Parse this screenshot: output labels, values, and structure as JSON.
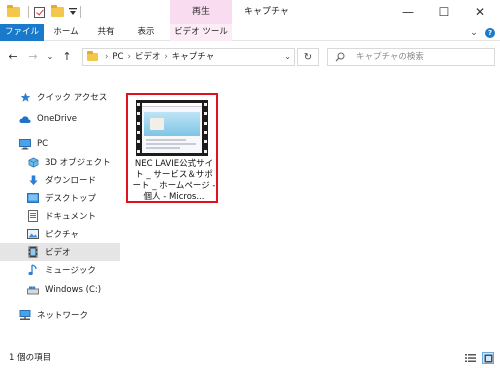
{
  "window": {
    "title": "キャプチャ",
    "context_group": "再生",
    "minimize_glyph": "—",
    "maximize_glyph": "☐",
    "close_glyph": "✕"
  },
  "ribbon": {
    "tabs": [
      {
        "label": "ファイル"
      },
      {
        "label": "ホーム"
      },
      {
        "label": "共有"
      },
      {
        "label": "表示"
      },
      {
        "label": "ビデオ ツール"
      }
    ],
    "expand_glyph": "⌄",
    "help_glyph": "?"
  },
  "nav": {
    "back_glyph": "←",
    "forward_glyph": "→",
    "recent_glyph": "⌄",
    "up_glyph": "↑",
    "address": {
      "segments": [
        "PC",
        "ビデオ",
        "キャプチャ"
      ],
      "separator": "›",
      "lead_separator": "›",
      "dropdown_glyph": "⌄"
    },
    "refresh_glyph": "↻",
    "search": {
      "placeholder": "キャプチャの検索"
    }
  },
  "sidebar": {
    "items": [
      {
        "label": "クイック アクセス",
        "icon": "star-icon"
      },
      {
        "label": "OneDrive",
        "icon": "cloud-icon"
      },
      {
        "label": "PC",
        "icon": "computer-icon"
      },
      {
        "label": "3D オブジェクト",
        "icon": "cube-icon"
      },
      {
        "label": "ダウンロード",
        "icon": "download-icon"
      },
      {
        "label": "デスクトップ",
        "icon": "desktop-icon"
      },
      {
        "label": "ドキュメント",
        "icon": "document-icon"
      },
      {
        "label": "ピクチャ",
        "icon": "picture-icon"
      },
      {
        "label": "ビデオ",
        "icon": "video-icon",
        "selected": true
      },
      {
        "label": "ミュージック",
        "icon": "music-icon"
      },
      {
        "label": "Windows (C:)",
        "icon": "drive-icon"
      },
      {
        "label": "ネットワーク",
        "icon": "network-icon"
      }
    ]
  },
  "main": {
    "files": [
      {
        "name": "NEC LAVIE公式サイト _ サービス＆サポート _ ホームページ - 個人 - Micros...",
        "type": "video",
        "highlight_color": "#e3101e"
      }
    ]
  },
  "status": {
    "text": "1 個の項目"
  },
  "colors": {
    "accent": "#1979ca",
    "context_tab": "#f9dcef",
    "selection": "#e5e5e5",
    "highlight": "#e3101e"
  }
}
